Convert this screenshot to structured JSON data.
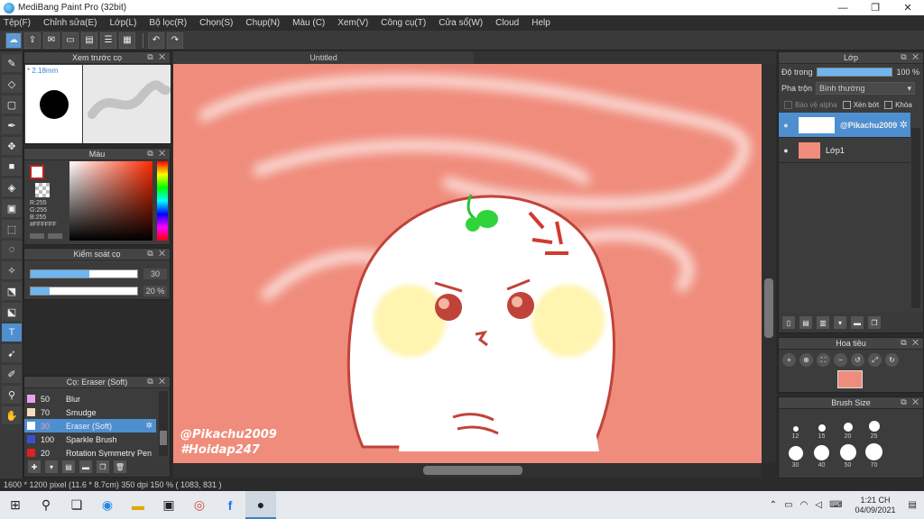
{
  "window": {
    "title": "MediBang Paint Pro (32bit)",
    "controls": [
      "—",
      "❐",
      "✕"
    ]
  },
  "menu": [
    "Tệp(F)",
    "Chỉnh sửa(E)",
    "Lớp(L)",
    "Bộ lọc(R)",
    "Chọn(S)",
    "Chụp(N)",
    "Màu (C)",
    "Xem(V)",
    "Công cụ(T)",
    "Cửa sổ(W)",
    "Cloud",
    "Help"
  ],
  "panels": {
    "brush_preview": {
      "title": "Xem trước cọ",
      "size": "* 2.18mm"
    },
    "color": {
      "title": "Màu",
      "r": "R:255",
      "g": "G:255",
      "b": "B:255",
      "hex": "#FFFFFF"
    },
    "brush_control": {
      "title": "Kiểm soát cọ",
      "size_value": "30",
      "size_fill": 0.55,
      "opacity_value": "20 %",
      "opacity_fill": 0.18
    },
    "brush_list": {
      "title": "Cọ: Eraser (Soft)",
      "items": [
        {
          "size": "50",
          "name": "Blur",
          "color": "#e9a0f0"
        },
        {
          "size": "70",
          "name": "Smudge",
          "color": "#f5dcc0"
        },
        {
          "size": "30",
          "name": "Eraser (Soft)",
          "color": "#ffffff",
          "selected": true
        },
        {
          "size": "100",
          "name": "Sparkle Brush",
          "color": "#3a4fd0"
        },
        {
          "size": "20",
          "name": "Rotation Symmetry Pen",
          "color": "#e02020"
        }
      ]
    },
    "layers": {
      "title": "Lớp",
      "opacity_label": "Độ trong",
      "opacity_value": "100 %",
      "blend_label": "Pha trộn",
      "blend_value": "Bình thường",
      "alpha_protect": "Bảo vệ alpha",
      "clipping": "Xén bớt",
      "lock": "Khóa",
      "items": [
        {
          "name": "@Pikachu2009",
          "selected": true
        },
        {
          "name": "Lớp1",
          "selected": false
        }
      ]
    },
    "navigator": {
      "title": "Hoa tiêu"
    },
    "brush_size": {
      "title": "Brush Size",
      "sizes": [
        "12",
        "15",
        "20",
        "25",
        "30",
        "40",
        "50",
        "70"
      ]
    }
  },
  "document": {
    "tab": "Untitled",
    "watermark_line1": "@Pikachu2009",
    "watermark_line2": "#Hoidap247"
  },
  "status": "1600 * 1200 pixel   (11.6 * 8.7cm)   350 dpi   150 %   ( 1083, 831 )",
  "taskbar": {
    "time": "1:21 CH",
    "date": "04/09/2021"
  }
}
